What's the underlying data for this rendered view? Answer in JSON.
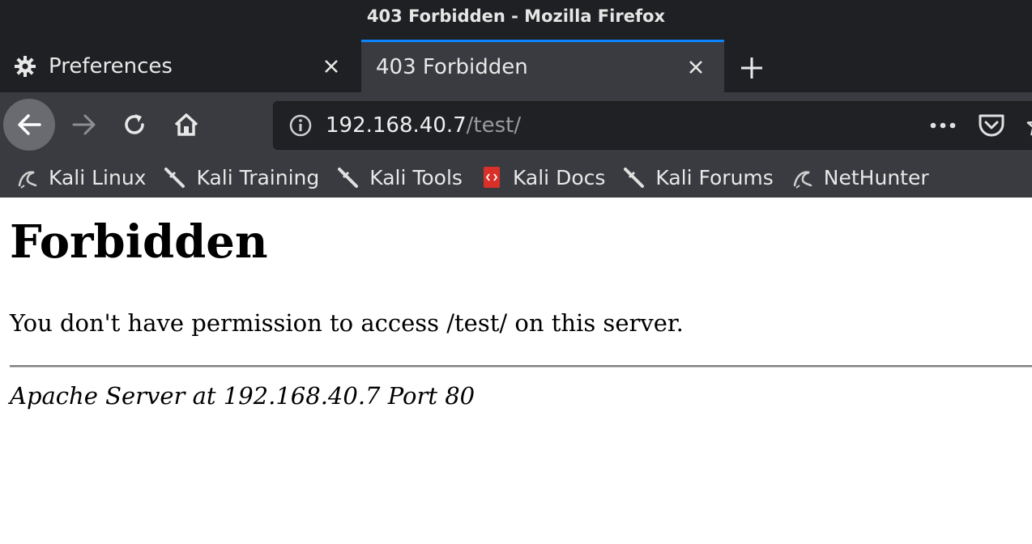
{
  "window": {
    "title": "403 Forbidden - Mozilla Firefox"
  },
  "tabs": [
    {
      "label": "Preferences",
      "icon": "gear-icon",
      "active": false
    },
    {
      "label": "403 Forbidden",
      "active": true
    }
  ],
  "navbar": {
    "url_host": "192.168.40.7",
    "url_path": "/test/"
  },
  "bookmarks": [
    {
      "label": "Kali Linux",
      "icon": "kali-dragon-icon"
    },
    {
      "label": "Kali Training",
      "icon": "kali-sword-icon"
    },
    {
      "label": "Kali Tools",
      "icon": "kali-sword-icon"
    },
    {
      "label": "Kali Docs",
      "icon": "kali-docs-icon"
    },
    {
      "label": "Kali Forums",
      "icon": "kali-sword-icon"
    },
    {
      "label": "NetHunter",
      "icon": "kali-dragon-icon"
    }
  ],
  "page": {
    "heading": "Forbidden",
    "message": "You don't have permission to access /test/ on this server.",
    "footer": "Apache Server at 192.168.40.7 Port 80"
  },
  "colors": {
    "chrome_dark": "#1f2023",
    "toolbar": "#393b40",
    "tab_accent": "#0a84ff",
    "url_background": "#202124"
  }
}
